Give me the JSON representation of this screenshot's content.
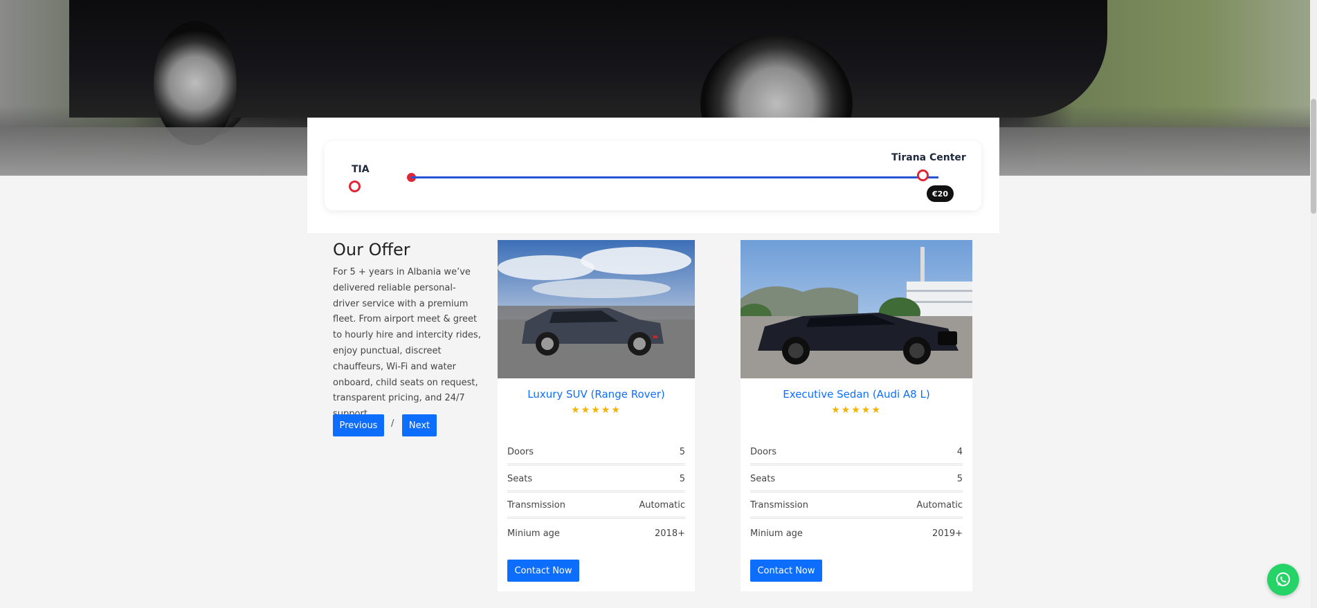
{
  "route": {
    "from": "TIA",
    "to": "Tirana Center",
    "price": "€20"
  },
  "offer": {
    "title": "Our Offer",
    "description": "For 5 + years in Albania we’ve delivered reliable personal-driver service with a premium fleet. From airport meet & greet to hourly hire and intercity rides, enjoy punctual, discreet chauffeurs, Wi-Fi and water onboard, child seats on request, transparent pricing, and 24/7 support.",
    "prev_label": "Previous",
    "separator": "/",
    "next_label": "Next"
  },
  "cars": [
    {
      "name": "Luxury SUV (Range Rover)",
      "rating": "★★★★★",
      "specs": [
        {
          "label": "Doors",
          "value": "5"
        },
        {
          "label": "Seats",
          "value": "5"
        },
        {
          "label": "Transmission",
          "value": "Automatic"
        },
        {
          "label": "Minium age",
          "value": "2018+"
        }
      ],
      "cta": "Contact Now"
    },
    {
      "name": "Executive Sedan (Audi A8 L)",
      "rating": "★★★★★",
      "specs": [
        {
          "label": "Doors",
          "value": "4"
        },
        {
          "label": "Seats",
          "value": "5"
        },
        {
          "label": "Transmission",
          "value": "Automatic"
        },
        {
          "label": "Minium age",
          "value": "2019+"
        }
      ],
      "cta": "Contact Now"
    }
  ],
  "colors": {
    "accent": "#0d6efd",
    "route_line": "#2653d4",
    "route_marker": "#e12533",
    "star": "#f5b301",
    "whatsapp": "#25d366"
  },
  "icons": {
    "whatsapp": "whatsapp-icon"
  }
}
